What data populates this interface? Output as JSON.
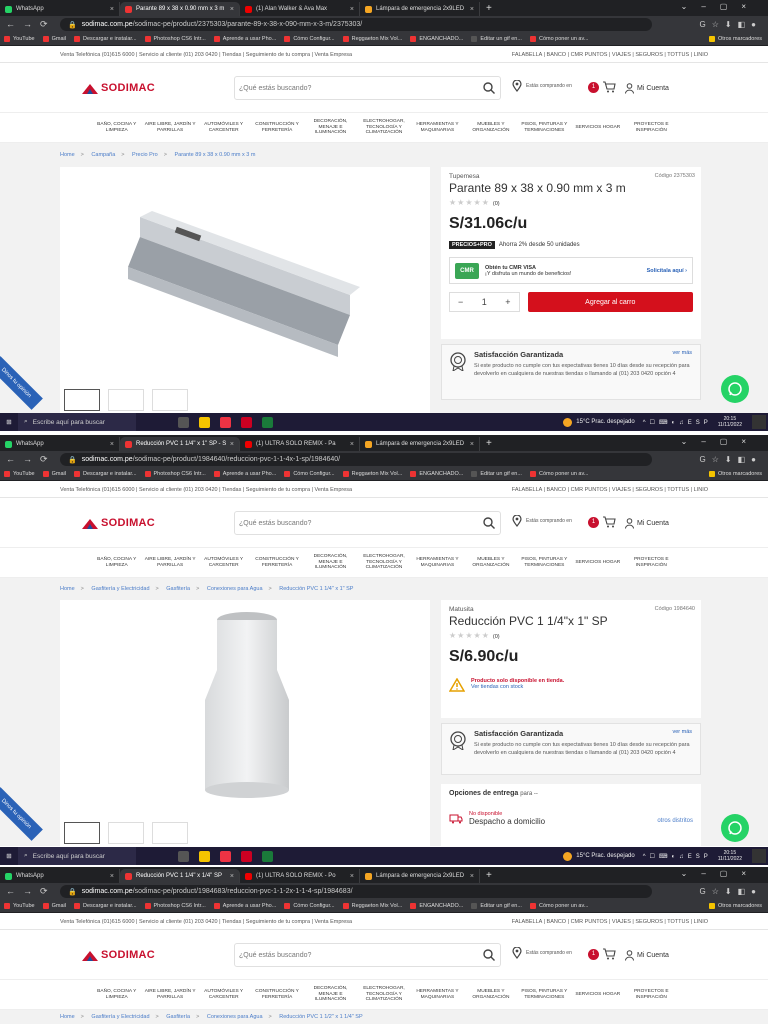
{
  "windows": [
    {
      "tabs": [
        {
          "label": "WhatsApp",
          "color": "#25d366",
          "active": false
        },
        {
          "label": "Parante 89 x 38 x 0.90 mm x 3 m",
          "color": "#e33",
          "active": true
        },
        {
          "label": "(1) Alan Walker & Ava Max",
          "color": "#e00",
          "active": false
        },
        {
          "label": "Lámpara de emergencia 2x9LED",
          "color": "#f5a623",
          "active": false
        }
      ],
      "url_host": "sodimac.com.pe",
      "url_path": "/sodimac-pe/product/2375303/parante-89-x-38-x-090-mm-x-3-m/2375303/",
      "breadcrumb": [
        "Home",
        "Campaña",
        "Precio Pro",
        "Parante 89 x 38 x 0.90 mm x 3 m"
      ],
      "product": {
        "brand": "Tupemesa",
        "code": "Código 2375303",
        "title": "Parante 89 x 38 x 0.90 mm x 3 m",
        "reviews": "(0)",
        "price": "S/31.06c/u",
        "promo_badge": "PRECIOS+PRO",
        "promo_text": "Ahorra 2% desde 50 unidades",
        "cmr_card": "CMR",
        "cmr_title": "Obtén tu CMR VISA",
        "cmr_sub": "¡Y disfruta un mundo de beneficios!",
        "cmr_link": "Solicítala aquí",
        "qty": "1",
        "add_to_cart": "Agregar al carro"
      },
      "time": "20:15"
    },
    {
      "tabs": [
        {
          "label": "WhatsApp",
          "color": "#25d366",
          "active": false
        },
        {
          "label": "Reducción PVC 1 1/4\" x 1\" SP - S",
          "color": "#e33",
          "active": true
        },
        {
          "label": "(1) ULTRA SOLO REMIX - Pa",
          "color": "#e00",
          "active": false
        },
        {
          "label": "Lámpara de emergencia 2x9LED",
          "color": "#f5a623",
          "active": false
        }
      ],
      "url_host": "sodimac.com.pe",
      "url_path": "/sodimac-pe/product/1984640/reduccion-pvc-1-1-4x-1-sp/1984640/",
      "breadcrumb": [
        "Home",
        "Gasfitería y Electricidad",
        "Gasfitería",
        "Conexiones para Agua",
        "Reducción PVC 1 1/4\" x 1\" SP"
      ],
      "product": {
        "brand": "Matusita",
        "code": "Código 1984640",
        "title": "Reducción PVC 1 1/4\"x 1\" SP",
        "reviews": "(0)",
        "price": "S/6.90c/u",
        "warn_title": "Producto solo disponible en tienda.",
        "warn_link": "Ver tiendas con stock",
        "delivery_title": "Opciones de entrega",
        "delivery_para": "para --",
        "not_available": "No disponible",
        "home_delivery": "Despacho a domicilio",
        "other_districts": "otros distritos"
      },
      "time": "20:15"
    },
    {
      "tabs": [
        {
          "label": "WhatsApp",
          "color": "#25d366",
          "active": false
        },
        {
          "label": "Reducción PVC 1 1/4\" x 1/4\" SP",
          "color": "#e33",
          "active": true
        },
        {
          "label": "(1) ULTRA SOLO REMIX - Po",
          "color": "#e00",
          "active": false
        },
        {
          "label": "Lámpara de emergencia 2x9LED",
          "color": "#f5a623",
          "active": false
        }
      ],
      "url_host": "sodimac.com.pe",
      "url_path": "/sodimac-pe/product/1984683/reduccion-pvc-1-1-2x-1-1-4-sp/1984683/",
      "breadcrumb": [
        "Home",
        "Gasfitería y Electricidad",
        "Gasfitería",
        "Conexiones para Agua",
        "Reducción PVC 1 1/2\" x 1 1/4\" SP"
      ]
    }
  ],
  "bookmarks": [
    "YouTube",
    "Gmail",
    "Descargar e instalar...",
    "Photoshop CS6 Intr...",
    "Aprende a usar Pho...",
    "Cómo Configur...",
    "Reggaeton Mix Vol...",
    "ENGANCHADO...",
    "Editar un gif en...",
    "Cómo poner un av..."
  ],
  "bookmarks_other": "Otros marcadores",
  "util_left": "Venta Telefónica (01)615 6000  |  Servicio al cliente (01) 203 0420  |  Tiendas  |  Seguimiento de tu compra  |  Venta Empresa",
  "util_right": "FALABELLA  |  BANCO  |  CMR PUNTOS  |  VIAJES  |  SEGUROS  |  TOTTUS  |  LINIO",
  "logo": "SODIMAC",
  "search_placeholder": "¿Qué estás buscando?",
  "location": "Estás comprando en",
  "cart_count": "1",
  "account": "Mi Cuenta",
  "categories": [
    "BAÑO, COCINA Y LIMPIEZA",
    "AIRE LIBRE, JARDÍN Y PARRILLAS",
    "AUTOMÓVILES Y CARCENTER",
    "CONSTRUCCIÓN Y FERRETERÍA",
    "DECORACIÓN, MENAJE E ILUMINACIÓN",
    "ELECTROHOGAR, TECNOLOGÍA Y CLIMATIZACIÓN",
    "HERRAMIENTAS Y MAQUINARIAS",
    "MUEBLES Y ORGANIZACIÓN",
    "PISOS, PINTURAS Y TERMINACIONES",
    "SERVICIOS HOGAR",
    "PROYECTOS E INSPIRACIÓN"
  ],
  "satisfaction": {
    "title": "Satisfacción Garantizada",
    "more": "ver más",
    "text": "Si este producto no cumple con tus expectativas tienes 10 días desde su recepción para devolverlo en cualquiera de nuestras tiendas o llamando al (01) 203 0420 opción 4"
  },
  "ribbon": "Dinos tu opinión",
  "taskbar": {
    "search": "Escribe aquí para buscar",
    "weather": "15°C  Prac. despejado",
    "lang": "ESP",
    "date": "11/11/2022"
  }
}
